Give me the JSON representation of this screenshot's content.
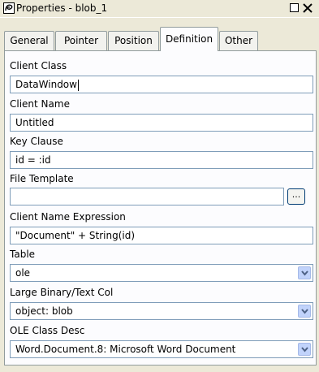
{
  "window": {
    "title": "Properties - blob_1",
    "icon": "properties-app-icon"
  },
  "tabs": [
    {
      "label": "General"
    },
    {
      "label": "Pointer"
    },
    {
      "label": "Position"
    },
    {
      "label": "Definition",
      "active": true
    },
    {
      "label": "Other"
    }
  ],
  "fields": {
    "client_class": {
      "label": "Client Class",
      "value": "DataWindow"
    },
    "client_name": {
      "label": "Client Name",
      "value": "Untitled"
    },
    "key_clause": {
      "label": "Key Clause",
      "value": "id = :id"
    },
    "file_template": {
      "label": "File Template",
      "value": "",
      "browse_label": "..."
    },
    "client_name_expression": {
      "label": "Client Name Expression",
      "value": "\"Document\" + String(id)"
    },
    "table": {
      "label": "Table",
      "value": "ole"
    },
    "large_binary_text_col": {
      "label": "Large Binary/Text Col",
      "value": "object: blob"
    },
    "ole_class_desc": {
      "label": "OLE Class Desc",
      "value": "Word.Document.8: Microsoft Word Document"
    }
  },
  "colors": {
    "window_bg": "#ece9d8",
    "panel_bg": "#fcfcfe",
    "field_border": "#7f9db9",
    "dropdown_button": "#c1d3fb"
  }
}
